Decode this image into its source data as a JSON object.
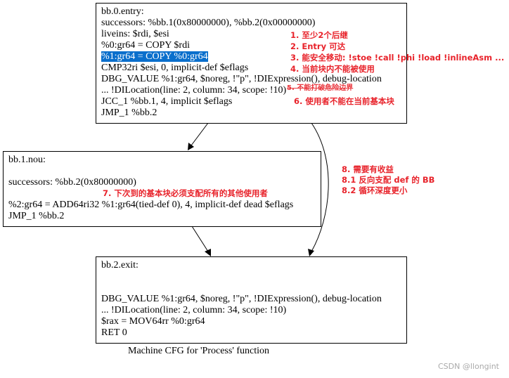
{
  "nodes": [
    {
      "title": "bb.0.entry:",
      "lines": [
        "successors: %bb.1(0x80000000), %bb.2(0x00000000)",
        "liveins: $rdi, $esi",
        "%0:gr64 = COPY $rdi",
        "%1:gr64 = COPY %0:gr64",
        "CMP32ri $esi, 0, implicit-def $eflags",
        "DBG_VALUE %1:gr64, $noreg, !\"p\", !DIExpression(), debug-location",
        "... !DILocation(line: 2, column: 34, scope: !10)",
        "JCC_1 %bb.1, 4, implicit $eflags",
        "JMP_1 %bb.2"
      ]
    },
    {
      "title": "bb.1.nou:",
      "lines": [
        "successors: %bb.2(0x80000000)",
        "%2:gr64 = ADD64ri32 %1:gr64(tied-def 0), 4, implicit-def dead $eflags",
        "JMP_1 %bb.2"
      ]
    },
    {
      "title": "bb.2.exit:",
      "lines": [
        "DBG_VALUE %1:gr64, $noreg, !\"p\", !DIExpression(), debug-location",
        "... !DILocation(line: 2, column: 34, scope: !10)",
        "$rax = MOV64rr %0:gr64",
        "RET 0"
      ]
    }
  ],
  "annotations": {
    "a1": "1. 至少2个后继",
    "a2": "2. Entry 可达",
    "a3": "3. 能安全移动: !stoe !call !phi !load !inlineAsm ...",
    "a4": "4. 当前块内不能被使用",
    "a5": "5. 不能打破危险边界",
    "a6": "6. 使用者不能在当前基本块",
    "a7": "7. 下次到的基本块必须支配所有的其他使用者",
    "a8": "8. 需要有收益",
    "a81": "8.1 反向支配 def 的 BB",
    "a82": "8.2 循环深度更小"
  },
  "highlight_color": "#0a6fcc",
  "annotation_color": "#e8232b",
  "caption": "Machine CFG for 'Process' function",
  "watermark": "CSDN @llongint"
}
